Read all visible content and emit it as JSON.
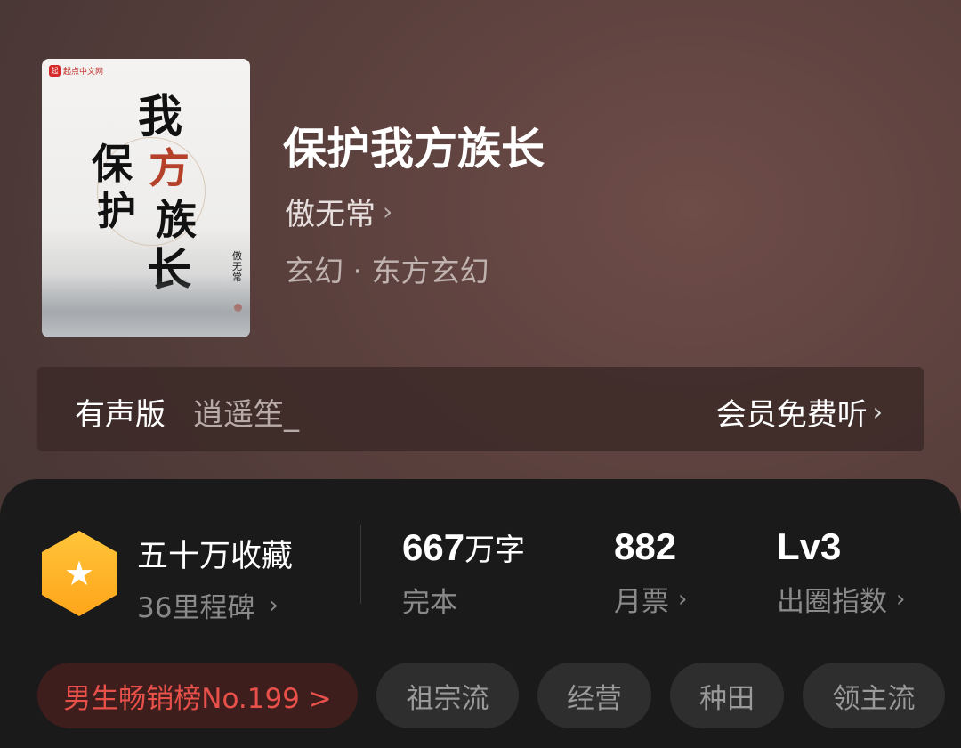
{
  "book": {
    "cover": {
      "publisher_logo": "起点中文网",
      "calligraphy": [
        "我",
        "保",
        "护",
        "方",
        "族",
        "长"
      ],
      "cover_author": "傲无常"
    },
    "title": "保护我方族长",
    "author": "傲无常",
    "genre": "玄幻 · 东方玄幻"
  },
  "audio": {
    "label": "有声版",
    "narrator": "逍遥笙_",
    "action": "会员免费听"
  },
  "stats": {
    "favorites": {
      "title": "五十万收藏",
      "sub": "36里程碑",
      "icon": "star-icon"
    },
    "words": {
      "value": "667",
      "unit": "万字",
      "sub": "完本"
    },
    "monthly_votes": {
      "value": "882",
      "sub": "月票"
    },
    "influence": {
      "value": "Lv3",
      "sub": "出圈指数"
    }
  },
  "tags": [
    {
      "label": "男生畅销榜No.199 >"
    },
    {
      "label": "祖宗流"
    },
    {
      "label": "经营"
    },
    {
      "label": "种田"
    },
    {
      "label": "领主流"
    }
  ],
  "colors": {
    "accent_rank": "#e8514a",
    "badge_gold": "#ffb020",
    "panel_bg": "#1a1a1a"
  }
}
